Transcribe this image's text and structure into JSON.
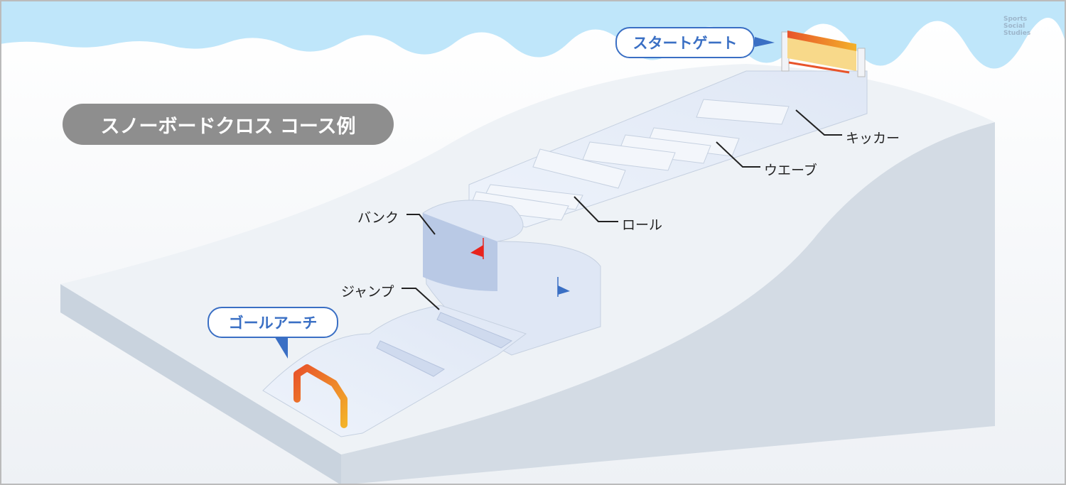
{
  "title": "スノーボードクロス コース例",
  "callouts": {
    "start_gate": "スタートゲート",
    "goal_arch": "ゴールアーチ"
  },
  "labels": {
    "kicker": "キッカー",
    "wave": "ウエーブ",
    "roll": "ロール",
    "bank": "バンク",
    "jump": "ジャンプ"
  },
  "logo": {
    "text": "Sports Social Studies"
  },
  "colors": {
    "sky": "#bfe6fa",
    "callout_border": "#3a6fc4",
    "title_bg": "#8e8e8e",
    "flag_red": "#e8231c",
    "flag_blue": "#3a6fc4",
    "arch_start": "#e8542a",
    "arch_end": "#f3b12a"
  }
}
